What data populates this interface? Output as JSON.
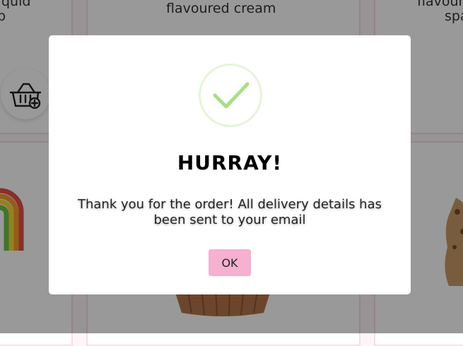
{
  "background": {
    "left_card_text_top": "quid",
    "left_card_text_bottom": "p",
    "center_card_text": "flavoured cream",
    "right_card_text_top": "flavour",
    "right_card_text_bottom": "spa",
    "basket_icon": "basket-add-icon"
  },
  "modal": {
    "icon": "check-icon",
    "title": "HURRAY!",
    "message": "Thank you for the order! All delivery details has been sent to your email",
    "ok_label": "OK",
    "colors": {
      "check": "#a9de8a",
      "check_ring": "#e5f4d8",
      "ok_button": "#f6b0d0"
    }
  }
}
